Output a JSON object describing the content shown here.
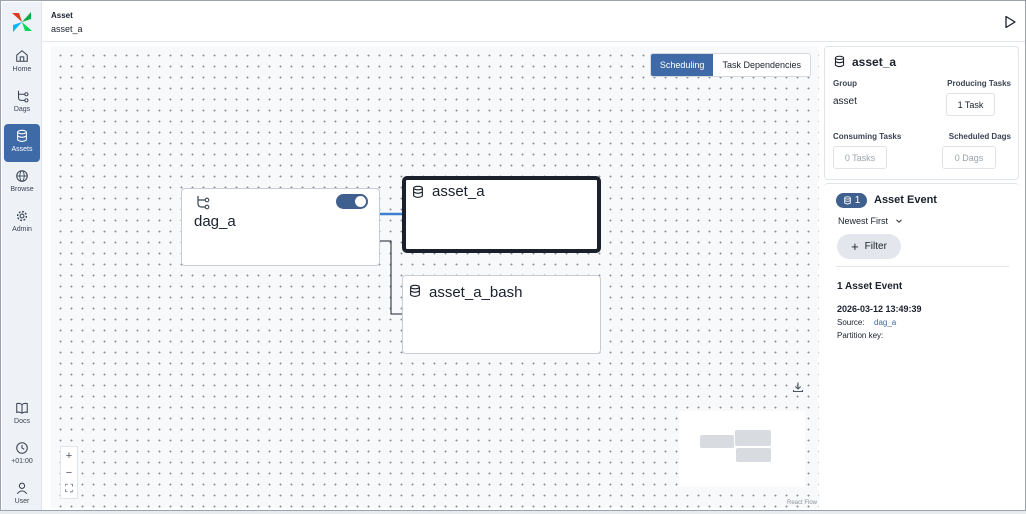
{
  "sidebar": {
    "items": [
      {
        "label": "Home",
        "icon": "home-icon"
      },
      {
        "label": "Dags",
        "icon": "dags-icon"
      },
      {
        "label": "Assets",
        "icon": "database-icon",
        "active": true
      },
      {
        "label": "Browse",
        "icon": "globe-icon"
      },
      {
        "label": "Admin",
        "icon": "gear-icon"
      }
    ],
    "bottom": [
      {
        "label": "Docs",
        "icon": "book-icon"
      },
      {
        "label": "+01:00",
        "icon": "clock-icon"
      },
      {
        "label": "User",
        "icon": "user-icon"
      }
    ]
  },
  "header": {
    "title": "Asset",
    "subtitle": "asset_a"
  },
  "graph": {
    "tabs": [
      "Scheduling",
      "Task Dependencies"
    ],
    "dag_node": "dag_a",
    "asset_node": "asset_a",
    "asset_bash_node": "asset_a_bash",
    "attribution": "React Flow",
    "zoom_in": "+",
    "zoom_out": "−",
    "fit": "⛶"
  },
  "panel": {
    "asset_name": "asset_a",
    "group_label": "Group",
    "group_value": "asset",
    "producing_label": "Producing Tasks",
    "producing_value": "1 Task",
    "consuming_label": "Consuming Tasks",
    "consuming_value": "0 Tasks",
    "scheduled_label": "Scheduled Dags",
    "scheduled_value": "0 Dags",
    "event_count": "1",
    "event_header": "Asset Event",
    "sort": "Newest First",
    "filter": "Filter",
    "events_title": "1 Asset Event",
    "event_time": "2026-03-12 13:49:39",
    "source_label": "Source:",
    "source_value": "dag_a",
    "partition_label": "Partition key:"
  },
  "colors": {
    "accent": "#3f6aa8",
    "badge": "#3f5f8e"
  }
}
